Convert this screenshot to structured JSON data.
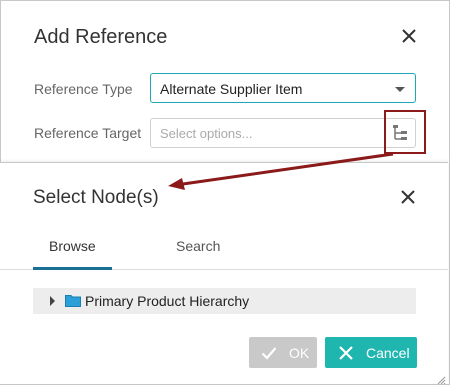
{
  "outer_dialog": {
    "title": "Add Reference",
    "reference_type_label": "Reference Type",
    "reference_type_value": "Alternate Supplier Item",
    "reference_target_label": "Reference Target",
    "reference_target_placeholder": "Select options..."
  },
  "inner_dialog": {
    "title": "Select Node(s)",
    "tabs": [
      {
        "label": "Browse",
        "active": true
      },
      {
        "label": "Search",
        "active": false
      }
    ],
    "tree": [
      {
        "label": "Primary Product Hierarchy",
        "expanded": false
      }
    ],
    "buttons": {
      "ok_label": "OK",
      "cancel_label": "Cancel"
    }
  },
  "colors": {
    "accent_teal": "#1fb6b0",
    "tab_underline": "#1a6f94",
    "annotation_red": "#8b1a1a",
    "folder_blue": "#2a9fd8"
  },
  "icons": [
    "close-icon",
    "tree-picker-icon",
    "expand-arrow-icon",
    "folder-icon",
    "check-icon",
    "x-icon",
    "resize-grip-icon"
  ]
}
